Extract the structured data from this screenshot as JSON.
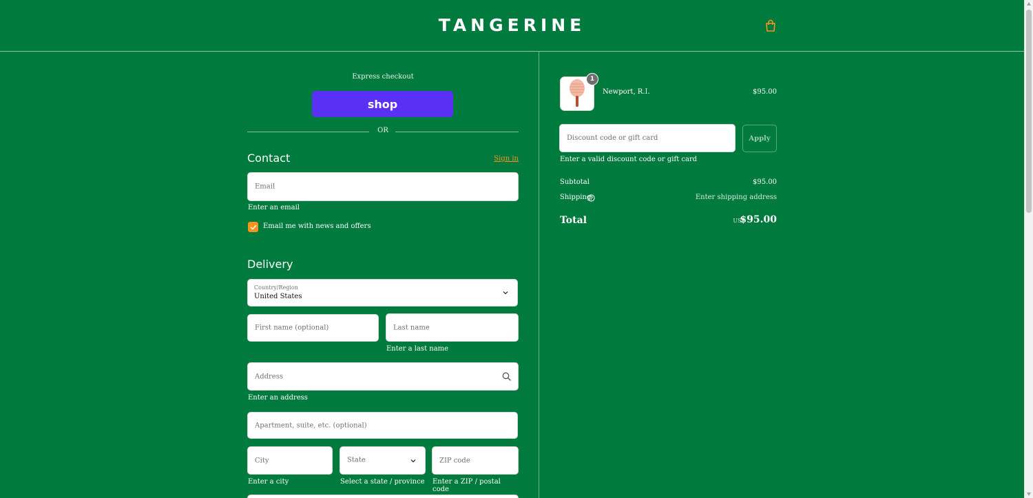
{
  "header": {
    "logo": "TANGERINE",
    "cart_icon": "shopping-bag-icon"
  },
  "checkout": {
    "express_label": "Express checkout",
    "shop_pay_label": "shop",
    "or_label": "OR",
    "contact": {
      "title": "Contact",
      "sign_in": "Sign in",
      "email_placeholder": "Email",
      "email_error": "Enter an email",
      "newsletter_label": "Email me with news and offers",
      "newsletter_checked": true
    },
    "delivery": {
      "title": "Delivery",
      "country_label": "Country/Region",
      "country_value": "United States",
      "first_name_placeholder": "First name (optional)",
      "last_name_placeholder": "Last name",
      "last_name_error": "Enter a last name",
      "address_placeholder": "Address",
      "address_error": "Enter an address",
      "apartment_placeholder": "Apartment, suite, etc. (optional)",
      "city_placeholder": "City",
      "city_error": "Enter a city",
      "state_placeholder": "State",
      "state_error": "Select a state / province",
      "zip_placeholder": "ZIP code",
      "zip_error": "Enter a ZIP / postal code"
    }
  },
  "summary": {
    "item": {
      "name": "Newport, R.I.",
      "price": "$95.00",
      "quantity": "1"
    },
    "discount_placeholder": "Discount code or gift card",
    "apply_label": "Apply",
    "discount_error": "Enter a valid discount code or gift card",
    "subtotal_label": "Subtotal",
    "subtotal_value": "$95.00",
    "shipping_label": "Shipping",
    "shipping_value": "Enter shipping address",
    "total_label": "Total",
    "total_currency": "USD",
    "total_value": "$95.00"
  },
  "colors": {
    "background": "#007a3d",
    "accent": "#f7941d",
    "shop_pay": "#5a31f4"
  }
}
